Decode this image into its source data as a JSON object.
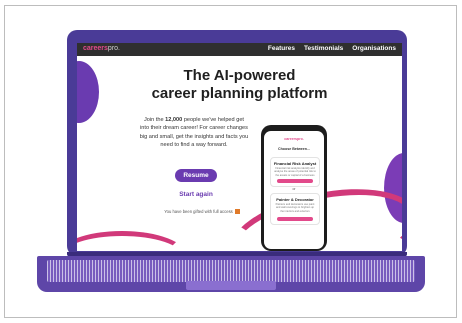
{
  "nav": {
    "brand_main": "careers",
    "brand_suffix": "pro.",
    "items": [
      "Features",
      "Testimonials",
      "Organisations"
    ]
  },
  "hero": {
    "headline_line1": "The AI-powered",
    "headline_line2": "career planning platform",
    "body_prefix": "Join the ",
    "body_count": "12,000",
    "body_rest": " people we've helped get into their dream career! For career changes big and small, get the insights and facts you need to find a way forward.",
    "resume_label": "Resume",
    "start_label": "Start again",
    "gift_text": "You have been gifted with full access"
  },
  "phone": {
    "brand": "careerspro.",
    "choose": "Choose Between...",
    "card1_title": "Financial Risk Analyst",
    "card1_desc": "Financial risk analysts identify and analyse the areas of potential risk to the assets or capital of a business",
    "or_text": "or",
    "card2_title": "Painter & Decorator",
    "card2_desc": "Painters and decorators use paint and wall coverings to brighten up the interiors and exteriors"
  },
  "colors": {
    "accent": "#6a3bb0",
    "pink": "#e24a8b",
    "laptop": "#4a3b97"
  }
}
